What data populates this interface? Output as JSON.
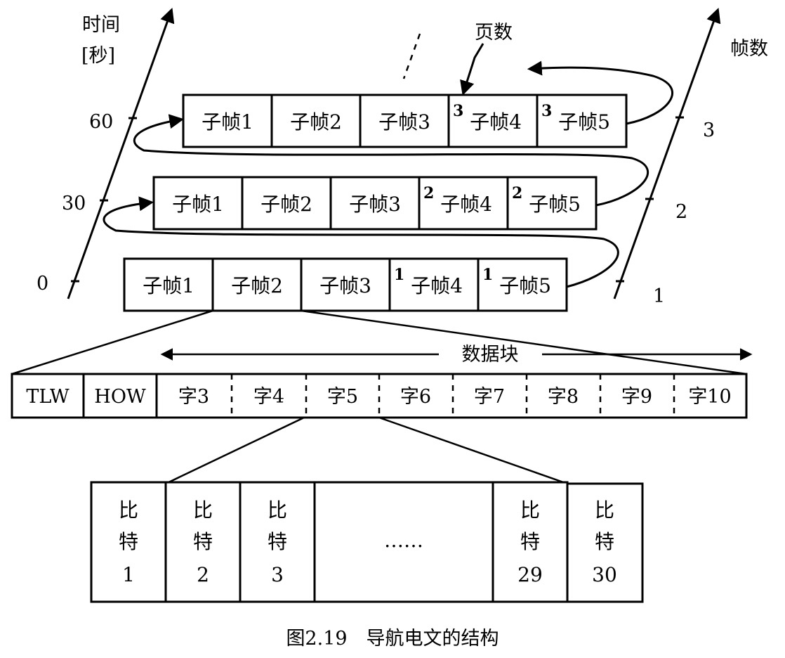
{
  "caption": "图2.19　导航电文的结构",
  "time_axis": {
    "label_line1": "时间",
    "label_line2": "[秒]",
    "ticks": [
      "0",
      "30",
      "60"
    ]
  },
  "frame_axis": {
    "label": "帧数",
    "ticks": [
      "1",
      "2",
      "3"
    ]
  },
  "page_label": "页数",
  "frames": [
    {
      "subframes": [
        "子帧1",
        "子帧2",
        "子帧3",
        "子帧4",
        "子帧5"
      ],
      "page": "1"
    },
    {
      "subframes": [
        "子帧1",
        "子帧2",
        "子帧3",
        "子帧4",
        "子帧5"
      ],
      "page": "2"
    },
    {
      "subframes": [
        "子帧1",
        "子帧2",
        "子帧3",
        "子帧4",
        "子帧5"
      ],
      "page": "3"
    }
  ],
  "data_block_label": "数据块",
  "words": [
    "TLW",
    "HOW",
    "字3",
    "字4",
    "字5",
    "字6",
    "字7",
    "字8",
    "字9",
    "字10"
  ],
  "bits": {
    "label_top": "比",
    "label_bottom": "特",
    "ellipsis": "……",
    "items": [
      "1",
      "2",
      "3",
      "29",
      "30"
    ]
  },
  "vertical_dots": "⋮"
}
